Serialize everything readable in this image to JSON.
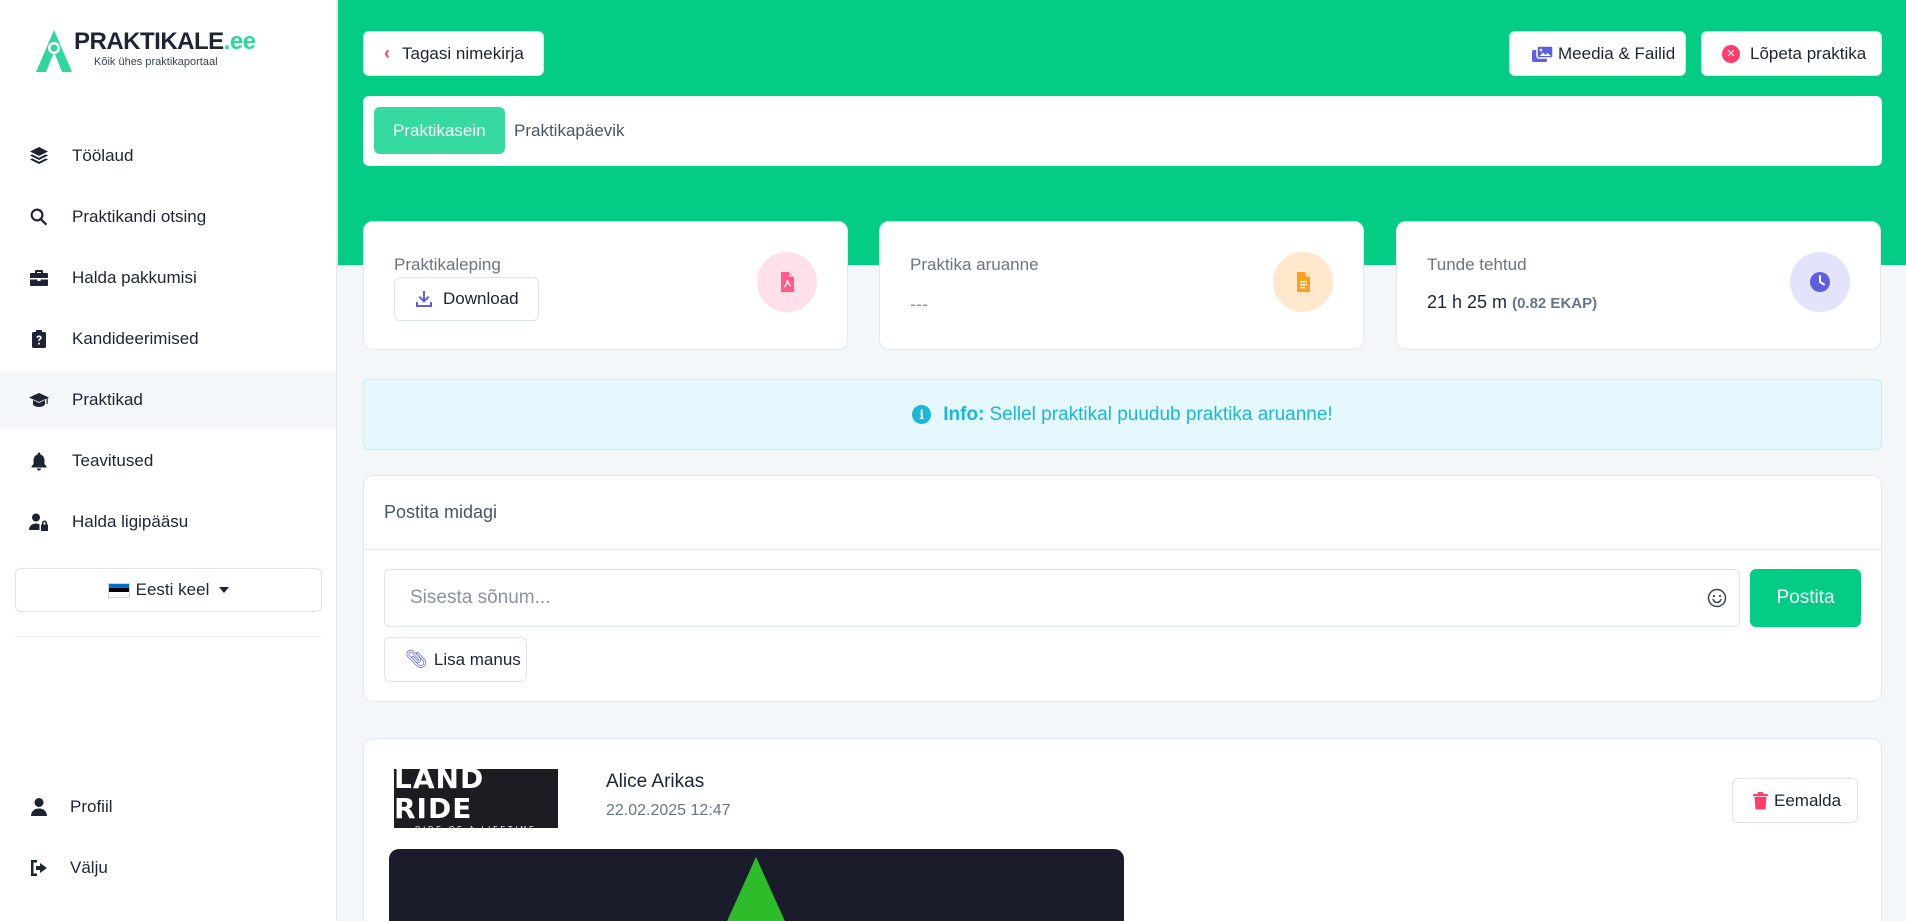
{
  "logo": {
    "title": "PRAKTIKALE",
    "title_suffix": ".ee",
    "subtitle": "Kõik ühes praktikaportaal"
  },
  "sidebar": {
    "items": [
      {
        "label": "Töölaud",
        "icon": "layers-icon"
      },
      {
        "label": "Praktikandi otsing",
        "icon": "search-icon"
      },
      {
        "label": "Halda pakkumisi",
        "icon": "briefcase-icon"
      },
      {
        "label": "Kandideerimised",
        "icon": "clipboard-question-icon"
      },
      {
        "label": "Praktikad",
        "icon": "graduation-cap-icon",
        "active": true
      },
      {
        "label": "Teavitused",
        "icon": "bell-icon"
      },
      {
        "label": "Halda ligipääsu",
        "icon": "user-lock-icon"
      }
    ],
    "language": "Eesti keel",
    "bottom": [
      {
        "label": "Profiil",
        "icon": "user-icon"
      },
      {
        "label": "Välju",
        "icon": "sign-out-icon"
      }
    ]
  },
  "header": {
    "back_label": "Tagasi nimekirja",
    "media_label": "Meedia & Failid",
    "end_label": "Lõpeta praktika"
  },
  "tabs": [
    {
      "label": "Praktikasein",
      "active": true
    },
    {
      "label": "Praktikapäevik",
      "active": false
    }
  ],
  "stats": {
    "contract": {
      "label": "Praktikaleping",
      "button": "Download"
    },
    "report": {
      "label": "Praktika aruanne",
      "value": "---"
    },
    "hours": {
      "label": "Tunde tehtud",
      "value": "21 h 25 m",
      "ekap": "(0.82 EKAP)"
    }
  },
  "alert": {
    "strong": "Info:",
    "text": "Sellel praktikal puudub praktika aruanne!"
  },
  "composer": {
    "title": "Postita midagi",
    "placeholder": "Sisesta sõnum...",
    "post_button": "Postita",
    "attach_button": "Lisa manus"
  },
  "feed": {
    "brand_logo": {
      "main": "LAND RIDE",
      "tagline": "RIDE OF A LIFETIME"
    },
    "author": "Alice Arikas",
    "date": "22.02.2025 12:47",
    "remove_button": "Eemalda"
  },
  "colors": {
    "accent": "#03cc85",
    "danger": "#ff3d6b",
    "info": "#1bb7d6",
    "indigo": "#5b5fe0"
  }
}
